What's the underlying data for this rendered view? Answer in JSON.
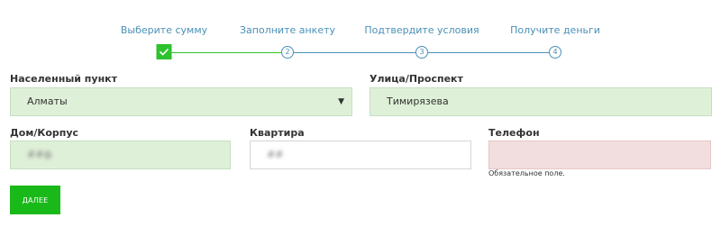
{
  "stepper": {
    "steps": [
      {
        "label": "Выберите сумму",
        "number": "",
        "state": "done"
      },
      {
        "label": "Заполните анкету",
        "number": "2",
        "state": "todo"
      },
      {
        "label": "Подтвердите условия",
        "number": "3",
        "state": "todo"
      },
      {
        "label": "Получите деньги",
        "number": "4",
        "state": "todo"
      }
    ],
    "colors": {
      "done": "#2ec22e",
      "todo": "#4a90b8"
    }
  },
  "form": {
    "city": {
      "label": "Населенный пункт",
      "value": "Алматы"
    },
    "street": {
      "label": "Улица/Проспект",
      "value": "Тимирязева"
    },
    "house": {
      "label": "Дом/Корпус",
      "value": "##ф"
    },
    "apartment": {
      "label": "Квартира",
      "value": "##"
    },
    "phone": {
      "label": "Телефон",
      "value": "",
      "error": "Обязательное поле."
    }
  },
  "actions": {
    "next_label": "ДАЛЕЕ"
  }
}
